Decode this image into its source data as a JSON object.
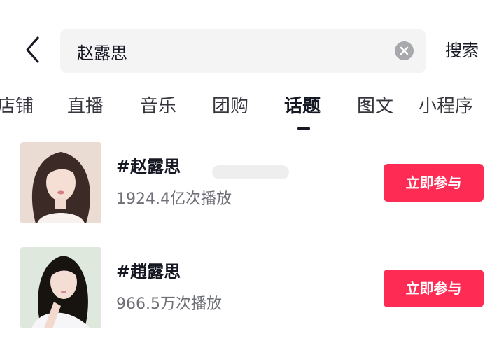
{
  "search": {
    "query": "赵露思",
    "submit_label": "搜索"
  },
  "tabs": [
    {
      "label": "店铺",
      "active": false
    },
    {
      "label": "直播",
      "active": false
    },
    {
      "label": "音乐",
      "active": false
    },
    {
      "label": "团购",
      "active": false
    },
    {
      "label": "话题",
      "active": true
    },
    {
      "label": "图文",
      "active": false
    },
    {
      "label": "小程序",
      "active": false
    }
  ],
  "results": [
    {
      "title": "#赵露思",
      "plays": "1924.4亿次播放",
      "button": "立即参与"
    },
    {
      "title": "#趙露思",
      "plays": "966.5万次播放",
      "button": "立即参与"
    }
  ],
  "colors": {
    "accent": "#fe2c55",
    "text_primary": "#161823",
    "text_secondary": "#6e6f76",
    "search_bg": "#f4f4f5"
  },
  "icons": [
    "back-arrow-icon",
    "clear-icon"
  ]
}
